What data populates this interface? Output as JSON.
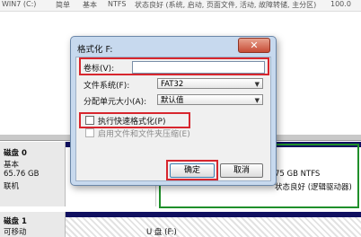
{
  "top_row": {
    "col1": "WIN7 (C:)",
    "col2": "简单",
    "col3": "基本",
    "col4": "NTFS",
    "col5": "状态良好 (系统, 启动, 页面文件, 活动, 故障转储, 主分区)",
    "col6": "100.0"
  },
  "disk0": {
    "title": "磁盘 0",
    "type": "基本",
    "size": "65.76 GB",
    "status": "联机"
  },
  "disk1": {
    "title": "磁盘 1",
    "type": "可移动",
    "partial": "U 盘 (F:)"
  },
  "partition_right": {
    "size": "75 GB NTFS",
    "status": "状态良好 (逻辑驱动器)"
  },
  "dialog": {
    "title": "格式化 F:",
    "close": "✕",
    "volume_label": "卷标(V):",
    "volume_value": "",
    "filesystem_label": "文件系统(F):",
    "filesystem_value": "FAT32",
    "allocation_label": "分配单元大小(A):",
    "allocation_value": "默认值",
    "quick_format": "执行快速格式化(P)",
    "compression": "启用文件和文件夹压缩(E)",
    "ok": "确定",
    "cancel": "取消"
  },
  "colors": {
    "dialog_frame": "#c7d9ee",
    "highlight_red": "#d7262e",
    "highlight_green": "#1f8f2a",
    "partition_bar": "#101060"
  }
}
